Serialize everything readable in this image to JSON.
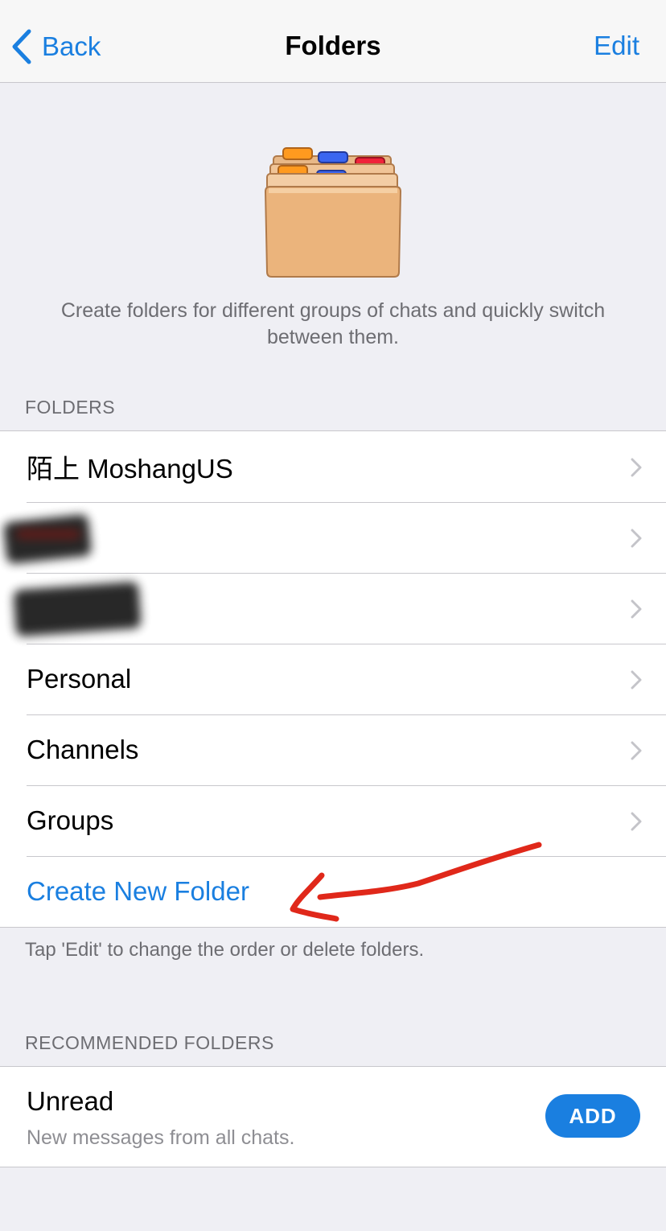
{
  "nav": {
    "back_label": "Back",
    "title": "Folders",
    "edit_label": "Edit"
  },
  "hero": {
    "icon": "folder-cabinet-icon",
    "description": "Create folders for different groups of chats and quickly switch between them."
  },
  "folders_section": {
    "header": "FOLDERS",
    "items": [
      {
        "label": "陌上 MoshangUS",
        "redacted": false
      },
      {
        "label": "",
        "redacted": true
      },
      {
        "label": "",
        "redacted": true
      },
      {
        "label": "Personal",
        "redacted": false
      },
      {
        "label": "Channels",
        "redacted": false
      },
      {
        "label": "Groups",
        "redacted": false
      }
    ],
    "create_label": "Create New Folder",
    "footer": "Tap 'Edit' to change the order or delete folders."
  },
  "recommended_section": {
    "header": "RECOMMENDED FOLDERS",
    "items": [
      {
        "title": "Unread",
        "subtitle": "New messages from all chats.",
        "button_label": "ADD"
      }
    ]
  },
  "colors": {
    "accent": "#1a7fe0",
    "background": "#efeff4",
    "annotation": "#e0281a"
  }
}
